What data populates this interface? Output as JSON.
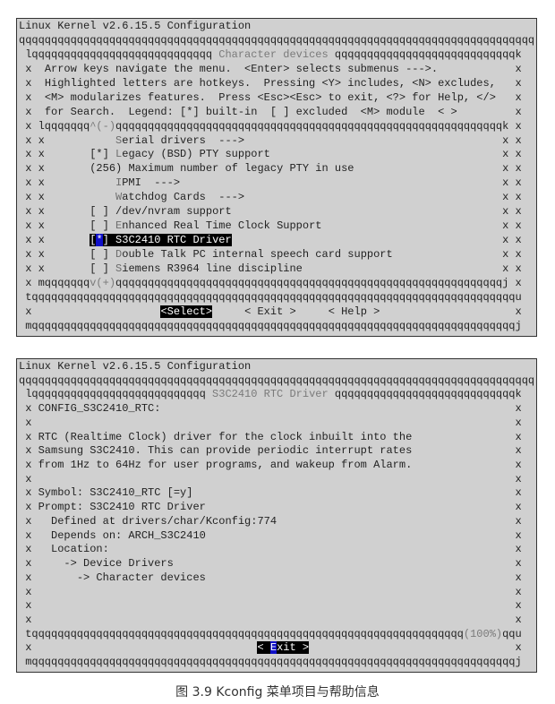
{
  "border": {
    "h": "q",
    "v": "x",
    "tl": "l",
    "tr": "k",
    "bl": "m",
    "br": "j",
    "lt": "t",
    "rt": "u"
  },
  "menu_screen": {
    "window_title": "Linux Kernel v2.6.15.5 Configuration",
    "dialog_title": "Character devices",
    "help_lines": [
      "Arrow keys navigate the menu.  <Enter> selects submenus --->.",
      "Highlighted letters are hotkeys.  Pressing <Y> includes, <N> excludes,",
      "<M> modularizes features.  Press <Esc><Esc> to exit, <?> for Help, </>",
      "for Search.  Legend: [*] built-in  [ ] excluded  <M> module  < >"
    ],
    "scroll_up_indicator": "^(-)",
    "scroll_down_indicator": "v(+)",
    "items": [
      {
        "mark": "",
        "hotkey": "S",
        "rest": "erial drivers  --->",
        "selected": false
      },
      {
        "mark": "[*]",
        "hotkey": "L",
        "rest": "egacy (BSD) PTY support",
        "selected": false
      },
      {
        "mark": "(256)",
        "hotkey": "",
        "rest": "Maximum number of legacy PTY in use",
        "selected": false
      },
      {
        "mark": "",
        "hotkey": "I",
        "rest": "PMI  --->",
        "selected": false
      },
      {
        "mark": "",
        "hotkey": "W",
        "rest": "atchdog Cards  --->",
        "selected": false
      },
      {
        "mark": "[ ]",
        "hotkey": "",
        "rest": "/dev/nvram support",
        "selected": false
      },
      {
        "mark": "[ ]",
        "hotkey": "E",
        "rest": "nhanced Real Time Clock Support",
        "selected": false
      },
      {
        "mark": "[*]",
        "hotkey": "S",
        "rest": "3C2410 RTC Driver",
        "selected": true
      },
      {
        "mark": "[ ]",
        "hotkey": "D",
        "rest": "ouble Talk PC internal speech card support",
        "selected": false
      },
      {
        "mark": "[ ]",
        "hotkey": "S",
        "rest": "iemens R3964 line discipline",
        "selected": false
      }
    ],
    "buttons": [
      "<Select>",
      "< Exit >",
      "< Help >"
    ]
  },
  "help_screen": {
    "window_title": "Linux Kernel v2.6.15.5 Configuration",
    "dialog_title": "S3C2410 RTC Driver",
    "lines": [
      "CONFIG_S3C2410_RTC:",
      "",
      "RTC (Realtime Clock) driver for the clock inbuilt into the",
      "Samsung S3C2410. This can provide periodic interrupt rates",
      "from 1Hz to 64Hz for user programs, and wakeup from Alarm.",
      "",
      "Symbol: S3C2410_RTC [=y]",
      "Prompt: S3C2410 RTC Driver",
      "  Defined at drivers/char/Kconfig:774",
      "  Depends on: ARCH_S3C2410",
      "  Location:",
      "    -> Device Drivers",
      "      -> Character devices",
      "",
      "",
      ""
    ],
    "scroll_percent": "(100%)",
    "exit_button": "< Exit >"
  },
  "caption": "图 3.9   Kconfig 菜单项目与帮助信息"
}
